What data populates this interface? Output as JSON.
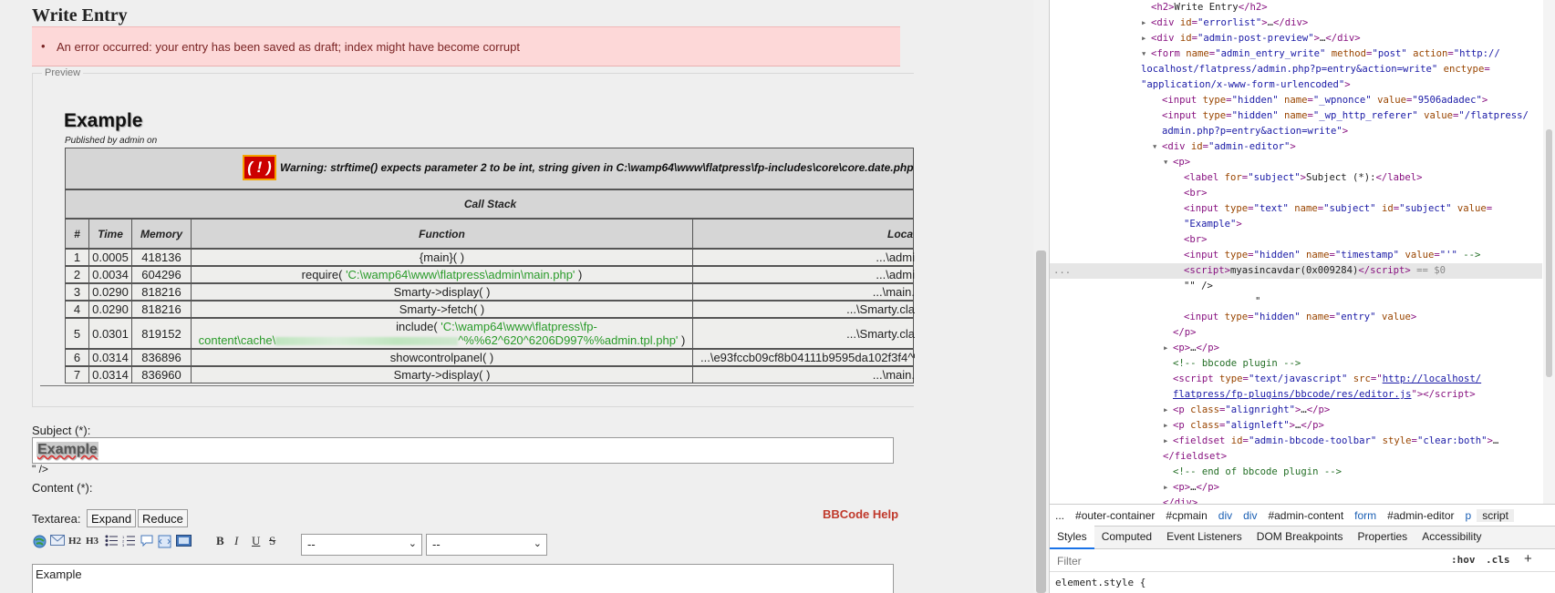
{
  "page": {
    "title": "Write Entry",
    "error": "An error occurred: your entry has been saved as draft; index might have become corrupt",
    "preview_legend": "Preview",
    "entry_title": "Example",
    "published": "Published by admin on",
    "warning_badge": "( ! )",
    "warning_text": "Warning: strftime() expects parameter 2 to be int, string given in C:\\wamp64\\www\\flatpress\\fp-includes\\core\\core.date.php",
    "callstack_label": "Call Stack",
    "headers": [
      "#",
      "Time",
      "Memory",
      "Function",
      "Loca"
    ],
    "rows": [
      {
        "n": "1",
        "time": "0.0005",
        "mem": "418136",
        "fn": "{main}( )",
        "loc": "...\\admi"
      },
      {
        "n": "2",
        "time": "0.0034",
        "mem": "604296",
        "fn_pre": "require( ",
        "fn_arg": "'C:\\wamp64\\www\\flatpress\\admin\\main.php'",
        "fn_post": " )",
        "loc": "...\\admi"
      },
      {
        "n": "3",
        "time": "0.0290",
        "mem": "818216",
        "fn": "Smarty->display( )",
        "loc": "...\\main."
      },
      {
        "n": "4",
        "time": "0.0290",
        "mem": "818216",
        "fn": "Smarty->fetch( )",
        "loc": "...\\Smarty.cla"
      },
      {
        "n": "5",
        "time": "0.0301",
        "mem": "819152",
        "fn_pre": "include( ",
        "fn_arg1": "'C:\\wamp64\\www\\flatpress\\fp-",
        "fn_arg2a": "content\\cache\\",
        "fn_arg2b": "^%%62^620^6206D997%%admin.tpl.php'",
        "fn_post": " )",
        "loc": "...\\Smarty.cla"
      },
      {
        "n": "6",
        "time": "0.0314",
        "mem": "836896",
        "fn": "showcontrolpanel( )",
        "loc": "...\\e93fccb09cf8b04111b9595da102f3f4^%"
      },
      {
        "n": "7",
        "time": "0.0314",
        "mem": "836960",
        "fn": "Smarty->display( )",
        "loc": "...\\main."
      }
    ],
    "subject_label": "Subject (*):",
    "subject_value": "Example",
    "stray": "\" />",
    "content_label": "Content (*):",
    "textarea_label": "Textarea:",
    "expand": "Expand",
    "reduce": "Reduce",
    "bbcode_help": "BBCode Help",
    "toolbar_text": {
      "h2": "H2",
      "h3": "H3",
      "b": "B",
      "i": "I",
      "u": "U",
      "s": "S"
    },
    "select1": "--",
    "select2": "--",
    "content_value": "Example"
  },
  "devtools": {
    "crumbs": [
      "...",
      "#outer-container",
      "#cpmain",
      "div",
      "div",
      "#admin-content",
      "form",
      "#admin-editor",
      "p",
      "script"
    ],
    "tabs": [
      "Styles",
      "Computed",
      "Event Listeners",
      "DOM Breakpoints",
      "Properties",
      "Accessibility"
    ],
    "filter_placeholder": "Filter",
    "hov": ":hov",
    "cls": ".cls",
    "plus": "+",
    "element_style": "element.style {",
    "dots": "..."
  },
  "colors": {
    "error_bg": "#fdd8d8",
    "bbhelp": "#c0392b",
    "green_arg": "#2a9b2a",
    "active_tab": "#1a73e8"
  }
}
